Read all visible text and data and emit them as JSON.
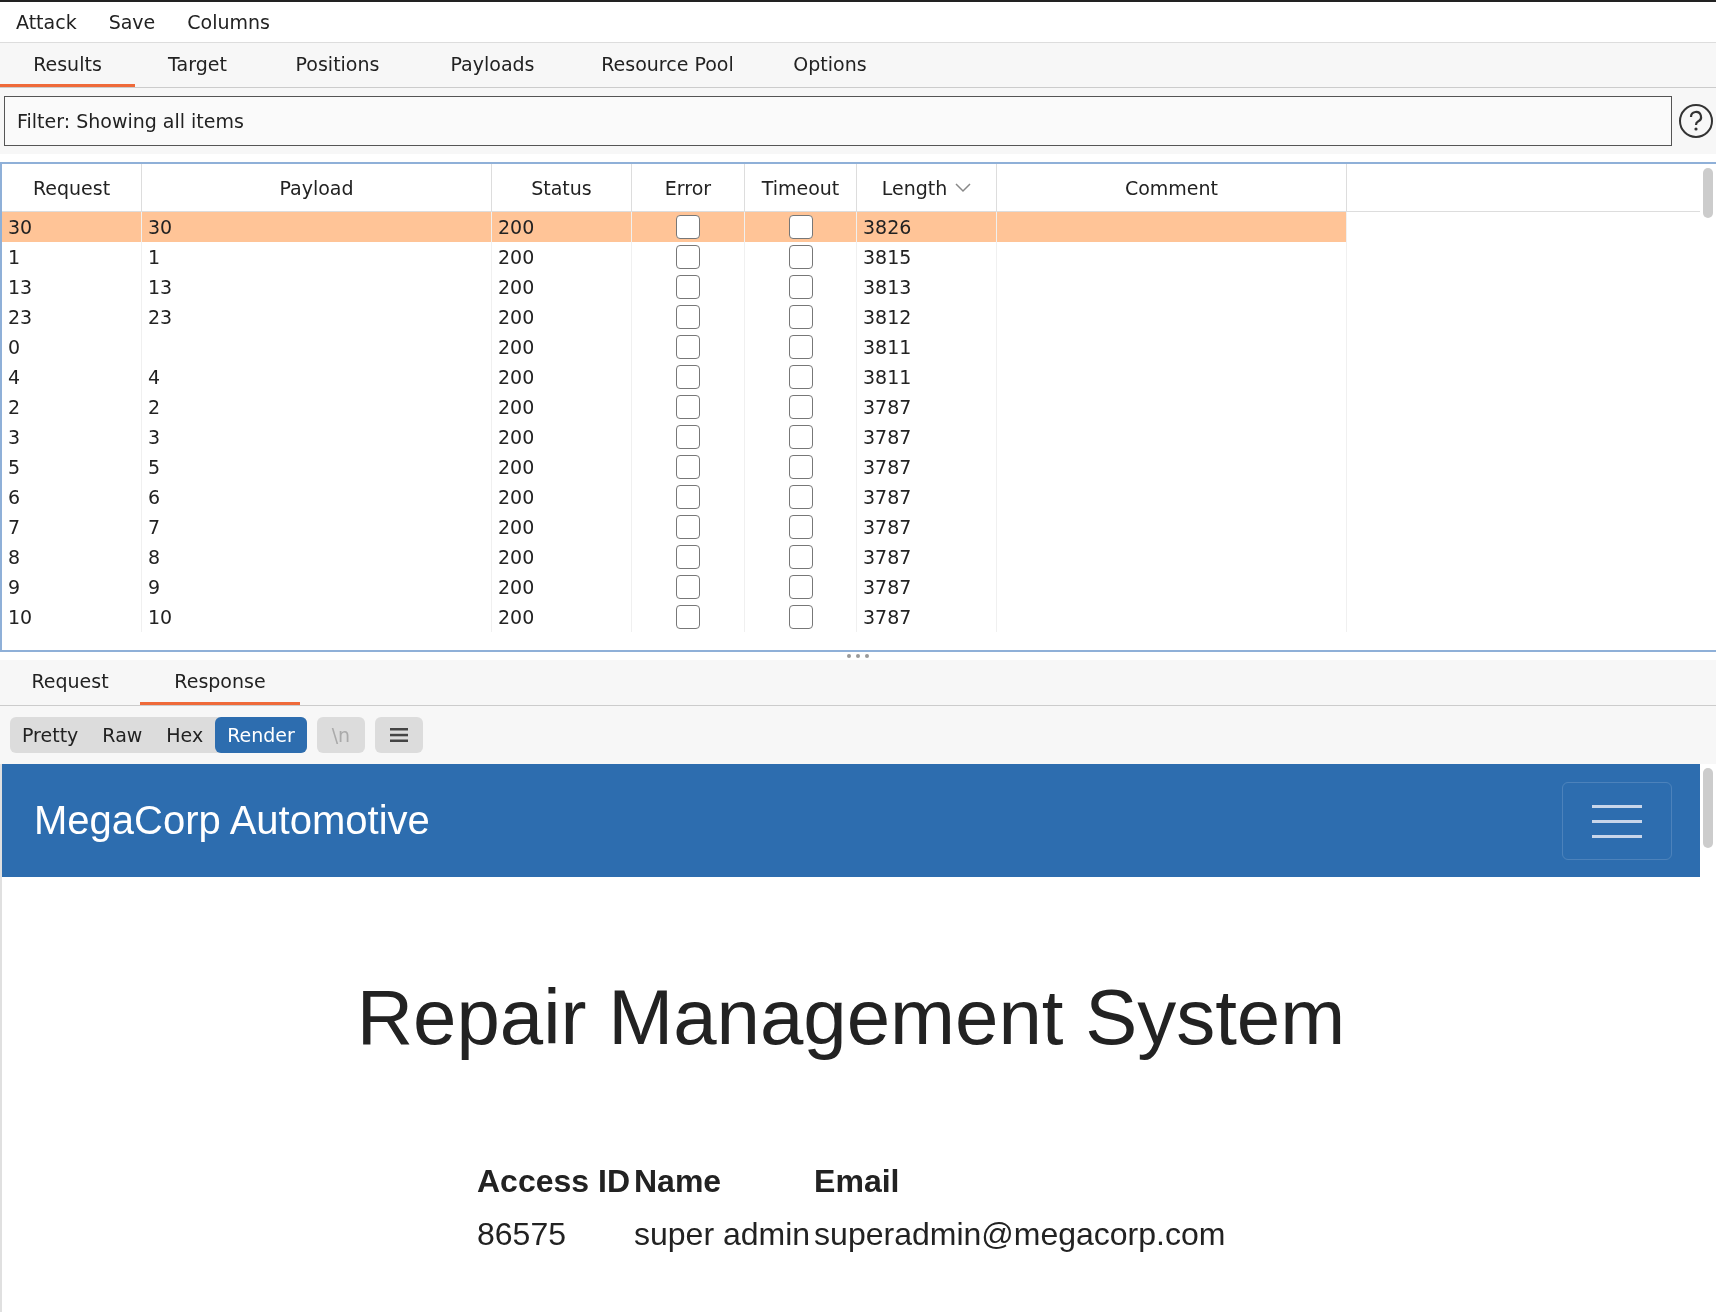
{
  "menu": [
    "Attack",
    "Save",
    "Columns"
  ],
  "tabs": [
    {
      "label": "Results",
      "selected": true
    },
    {
      "label": "Target",
      "selected": false
    },
    {
      "label": "Positions",
      "selected": false
    },
    {
      "label": "Payloads",
      "selected": false
    },
    {
      "label": "Resource Pool",
      "selected": false
    },
    {
      "label": "Options",
      "selected": false
    }
  ],
  "filter": {
    "value": "Filter: Showing all items"
  },
  "table": {
    "columns": [
      "Request",
      "Payload",
      "Status",
      "Error",
      "Timeout",
      "Length",
      "Comment"
    ],
    "rows": [
      {
        "request": "30",
        "payload": "30",
        "status": "200",
        "error": false,
        "timeout": false,
        "length": "3826",
        "selected": true
      },
      {
        "request": "1",
        "payload": "1",
        "status": "200",
        "error": false,
        "timeout": false,
        "length": "3815",
        "selected": false
      },
      {
        "request": "13",
        "payload": "13",
        "status": "200",
        "error": false,
        "timeout": false,
        "length": "3813",
        "selected": false
      },
      {
        "request": "23",
        "payload": "23",
        "status": "200",
        "error": false,
        "timeout": false,
        "length": "3812",
        "selected": false
      },
      {
        "request": "0",
        "payload": "",
        "status": "200",
        "error": false,
        "timeout": false,
        "length": "3811",
        "selected": false
      },
      {
        "request": "4",
        "payload": "4",
        "status": "200",
        "error": false,
        "timeout": false,
        "length": "3811",
        "selected": false
      },
      {
        "request": "2",
        "payload": "2",
        "status": "200",
        "error": false,
        "timeout": false,
        "length": "3787",
        "selected": false
      },
      {
        "request": "3",
        "payload": "3",
        "status": "200",
        "error": false,
        "timeout": false,
        "length": "3787",
        "selected": false
      },
      {
        "request": "5",
        "payload": "5",
        "status": "200",
        "error": false,
        "timeout": false,
        "length": "3787",
        "selected": false
      },
      {
        "request": "6",
        "payload": "6",
        "status": "200",
        "error": false,
        "timeout": false,
        "length": "3787",
        "selected": false
      },
      {
        "request": "7",
        "payload": "7",
        "status": "200",
        "error": false,
        "timeout": false,
        "length": "3787",
        "selected": false
      },
      {
        "request": "8",
        "payload": "8",
        "status": "200",
        "error": false,
        "timeout": false,
        "length": "3787",
        "selected": false
      },
      {
        "request": "9",
        "payload": "9",
        "status": "200",
        "error": false,
        "timeout": false,
        "length": "3787",
        "selected": false
      },
      {
        "request": "10",
        "payload": "10",
        "status": "200",
        "error": false,
        "timeout": false,
        "length": "3787",
        "selected": false
      }
    ]
  },
  "message_tabs": [
    {
      "label": "Request",
      "selected": false
    },
    {
      "label": "Response",
      "selected": true
    }
  ],
  "view_buttons": [
    {
      "label": "Pretty",
      "selected": false
    },
    {
      "label": "Raw",
      "selected": false
    },
    {
      "label": "Hex",
      "selected": false
    },
    {
      "label": "Render",
      "selected": true
    }
  ],
  "newline_toggle": {
    "label": "\\n",
    "on": false
  },
  "rendered_page": {
    "brand": "MegaCorp Automotive",
    "heading": "Repair Management System",
    "table": {
      "columns": [
        "Access ID",
        "Name",
        "Email"
      ],
      "rows": [
        [
          "86575",
          "super admin",
          "superadmin@megacorp.com"
        ]
      ]
    }
  }
}
